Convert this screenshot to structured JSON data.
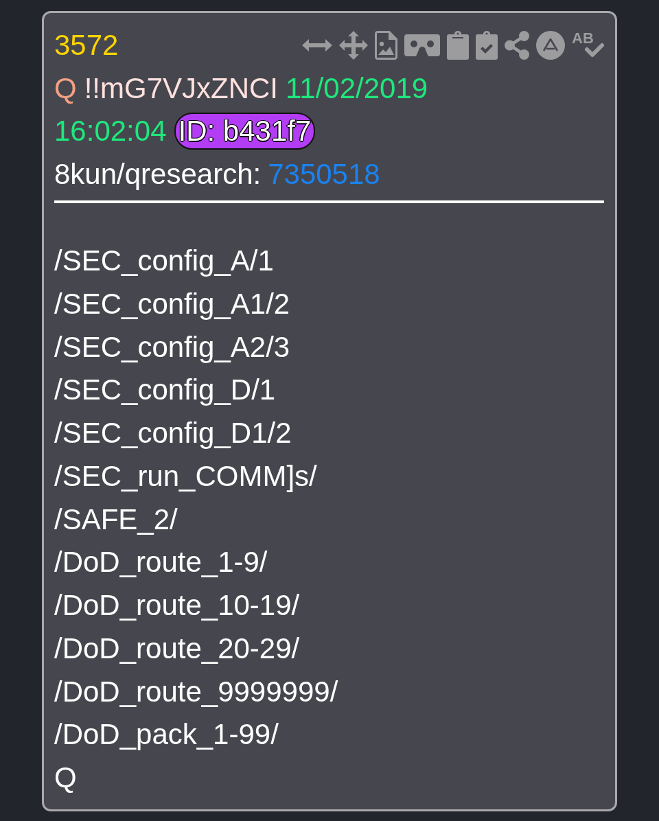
{
  "post": {
    "number": "3572",
    "toolbar": [
      {
        "kind": "resize"
      },
      {
        "kind": "move"
      },
      {
        "kind": "image-file"
      },
      {
        "kind": "vr-viewer"
      },
      {
        "kind": "clipboard"
      },
      {
        "kind": "clipboard-check"
      },
      {
        "kind": "share"
      },
      {
        "kind": "circle-a"
      },
      {
        "kind": "spellcheck",
        "label": "AB"
      }
    ],
    "author": "Q",
    "tripcode": "!!mG7VJxZNCI",
    "date": "11/02/2019",
    "time": "16:02:04",
    "id_badge": "ID: b431f7",
    "board": "8kun/qresearch:",
    "thread": "7350518"
  },
  "body": {
    "lines": [
      "/SEC_config_A/1",
      "/SEC_config_A1/2",
      "/SEC_config_A2/3",
      "/SEC_config_D/1",
      "/SEC_config_D1/2",
      "/SEC_run_COMM]s/",
      "/SAFE_2/",
      "/DoD_route_1-9/",
      "/DoD_route_10-19/",
      "/DoD_route_20-29/",
      "/DoD_route_9999999/",
      "/DoD_pack_1-99/",
      "Q"
    ]
  }
}
